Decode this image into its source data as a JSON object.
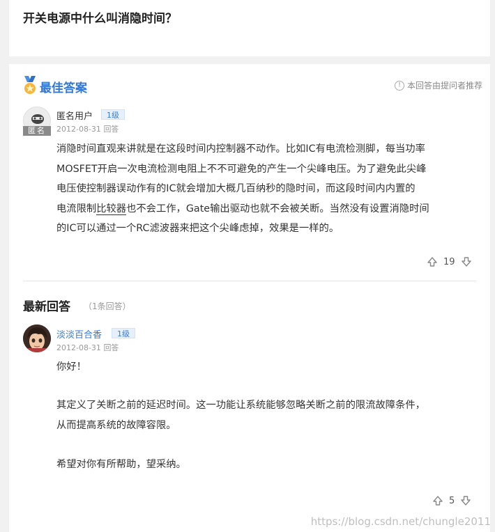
{
  "question": {
    "title": "开关电源中什么叫消隐时间？"
  },
  "best_answer": {
    "header": "最佳答案",
    "recommend_note": "本回答由提问者推荐",
    "user": {
      "name": "匿名用户",
      "avatar_tag": "匿名",
      "level": "1级",
      "date": "2012-08-31",
      "action": "回答"
    },
    "body_lines": [
      "消隐时间直观来讲就是在这段时间内控制器不动作。比如IC有电流检测脚，每当功率",
      "MOSFET开启一次电流检测电阻上不不可避免的产生一个尖峰电压。为了避免此尖峰",
      "电压使控制器误动作有的IC就会增加大概几百纳秒的隐时间，而这段时间内内置的",
      "电流限制",
      "比较器",
      "也不会工作，Gate输出驱动也就不会被关断。当然没有设置消隐时间",
      "的IC可以通过一个RC滤波器来把这个尖峰虑掉，效果是一样的。"
    ],
    "votes": "19"
  },
  "latest": {
    "title": "最新回答",
    "count": "（1条回答）",
    "user": {
      "name": "淡淡百合香",
      "level": "1级",
      "date": "2012-08-31",
      "action": "回答"
    },
    "greeting": "你好！",
    "paragraph_lines": [
      "其定义了关断之前的延迟时间。这一功能让系统能够忽略关断之前的限流故障条件，",
      "从而提高系统的故障容限。"
    ],
    "closing": "希望对你有所帮助，望采纳。",
    "votes": "5"
  },
  "watermark": "https://blog.csdn.net/chungle2011",
  "colors": {
    "accent_blue": "#3478d4",
    "page_bg": "#f1f1f1"
  },
  "icons": [
    "medal-icon",
    "info-icon",
    "thumbs-up-icon",
    "thumbs-down-icon",
    "anonymous-avatar-icon",
    "user-avatar-icon"
  ]
}
